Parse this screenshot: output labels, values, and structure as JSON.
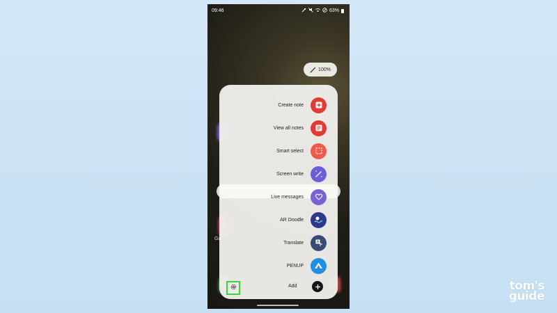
{
  "status_bar": {
    "time": "09:46",
    "battery": "63%"
  },
  "zoom": {
    "label": "100%"
  },
  "background_text": {
    "partial_label": "Ga"
  },
  "menu": {
    "items": [
      {
        "label": "Create note",
        "icon": "create-note-icon",
        "color": "#e23b33"
      },
      {
        "label": "View all notes",
        "icon": "notes-list-icon",
        "color": "#e23b33"
      },
      {
        "label": "Smart select",
        "icon": "smart-select-icon",
        "color": "#ef5a4d"
      },
      {
        "label": "Screen write",
        "icon": "screen-write-icon",
        "color": "#6a5fd6"
      },
      {
        "label": "Live messages",
        "icon": "heart-icon",
        "color": "#7a62d4"
      },
      {
        "label": "AR Doodle",
        "icon": "ar-doodle-icon",
        "color": "#2d3a8c"
      },
      {
        "label": "Translate",
        "icon": "translate-icon",
        "color": "#3a4a74"
      },
      {
        "label": "PENUP",
        "icon": "penup-icon",
        "color": "#1f8fe6"
      }
    ],
    "add_label": "Add"
  },
  "settings": {
    "icon": "gear-icon",
    "highlight_color": "#37d63a"
  },
  "watermark": {
    "line1": "tom's",
    "line2": "guide"
  }
}
